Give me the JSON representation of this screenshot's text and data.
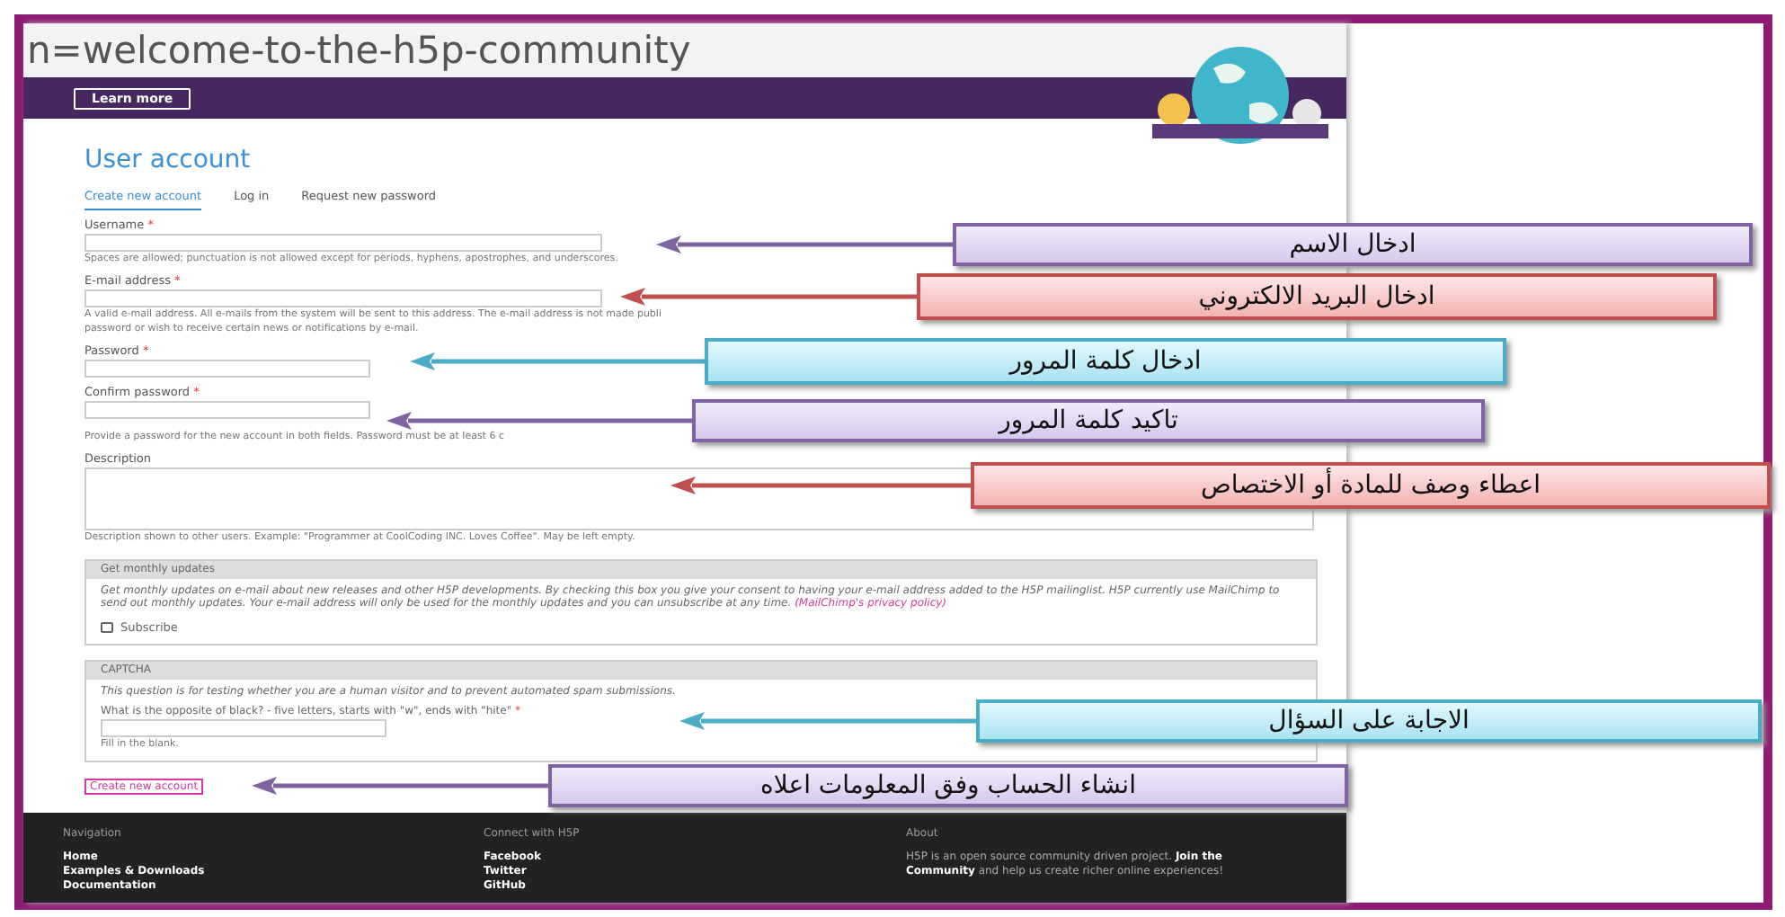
{
  "address_bar": {
    "url": "n=welcome-to-the-h5p-community"
  },
  "banner": {
    "button": "Learn more"
  },
  "page_title": "User account",
  "tabs": [
    {
      "label": "Create new account",
      "selected": true
    },
    {
      "label": "Log in",
      "selected": false
    },
    {
      "label": "Request new password",
      "selected": false
    }
  ],
  "fields": [
    {
      "kind": "text",
      "label": "Username",
      "required_mark": "*",
      "description_lines": [
        "Spaces are allowed; punctuation is not allowed except for periods, hyphens, apostrophes, and underscores."
      ]
    },
    {
      "kind": "text",
      "label": "E-mail address",
      "required_mark": "*",
      "description_lines": [
        "A valid e-mail address. All e-mails from the system will be sent to this address. The e-mail address is not made publi",
        "password or wish to receive certain news or notifications by e-mail."
      ]
    },
    {
      "kind": "short",
      "label": "Password",
      "required_mark": "*"
    },
    {
      "kind": "short",
      "label": "Confirm password",
      "required_mark": "*",
      "description_lines": [
        "Provide a password for the new account in both fields. Password must be at least 6 c"
      ]
    },
    {
      "kind": "textarea",
      "label": "Description",
      "description_lines": [
        "Description shown to other users. Example: \"Programmer at CoolCoding INC. Loves Coffee\". May be left empty."
      ]
    }
  ],
  "updates": {
    "legend": "Get monthly updates",
    "text": "Get monthly updates on e-mail about new releases and other H5P developments. By checking this box you give your consent to having your e-mail address added to the H5P mailinglist. H5P currently use MailChimp to send out monthly updates. Your e-mail address will only be used for the monthly updates and you can unsubscribe at any time.",
    "link": "(MailChimp's privacy policy)",
    "checkbox": {
      "label": "Subscribe",
      "checked": false
    }
  },
  "captcha": {
    "legend": "CAPTCHA",
    "intro": "This question is for testing whether you are a human visitor and to prevent automated spam submissions.",
    "question": "What is the opposite of black? - five letters, starts with \"w\", ends with \"hite\"",
    "required_mark": "*",
    "hint": "Fill in the blank."
  },
  "submit": "Create new account",
  "footer": [
    {
      "title": "Navigation",
      "links": [
        "Home",
        "Examples & Downloads",
        "Documentation"
      ]
    },
    {
      "title": "Connect with H5P",
      "links": [
        "Facebook",
        "Twitter",
        "GitHub"
      ]
    },
    {
      "title": "About",
      "text": "H5P is an open source community driven project. **Join the Community** and help us create richer online experiences!"
    }
  ],
  "callouts": [
    {
      "text": "ادخال الاسم",
      "color": "#8064a2"
    },
    {
      "text": "ادخال البريد الالكتروني",
      "color": "#c0504d"
    },
    {
      "text": "ادخال كلمة المرور",
      "color": "#4bacc6"
    },
    {
      "text": "تاكيد كلمة المرور",
      "color": "#8064a2"
    },
    {
      "text": "اعطاء وصف للمادة أو الاختصاص",
      "color": "#c0504d"
    },
    {
      "text": "الاجابة على السؤال",
      "color": "#4bacc6"
    },
    {
      "text": "انشاء الحساب وفق المعلومات اعلاه",
      "color": "#8064a2"
    }
  ]
}
